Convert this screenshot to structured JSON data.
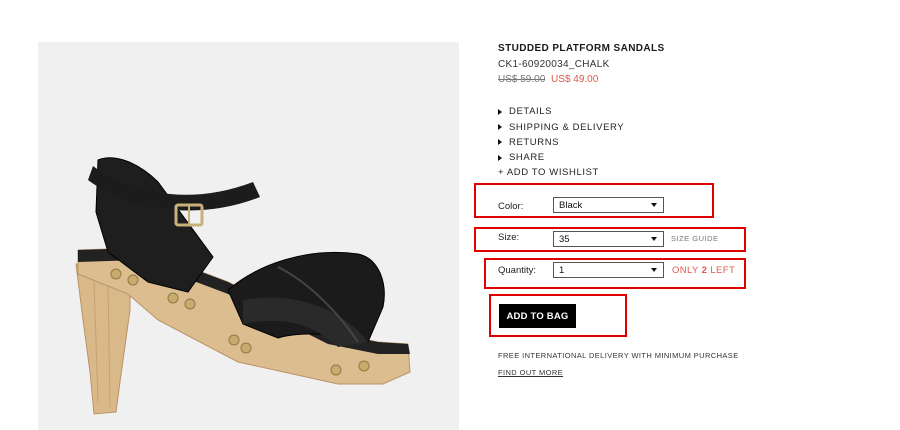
{
  "product": {
    "title": "STUDDED PLATFORM SANDALS",
    "sku": "CK1-60920034_CHALK",
    "old_price": "US$ 59.00",
    "new_price": "US$ 49.00",
    "image_icon": "sandal-product-photo"
  },
  "accordion": {
    "details": "DETAILS",
    "shipping": "SHIPPING & DELIVERY",
    "returns": "RETURNS",
    "share": "SHARE"
  },
  "wishlist": "+ ADD TO WISHLIST",
  "options": {
    "color_label": "Color:",
    "color_value": "Black",
    "size_label": "Size:",
    "size_value": "35",
    "size_guide": "SIZE GUIDE",
    "quantity_label": "Quantity:",
    "quantity_value": "1",
    "stock_prefix": "ONLY",
    "stock_count": "2",
    "stock_suffix": "LEFT"
  },
  "add_to_bag": "ADD TO BAG",
  "delivery_note": "FREE INTERNATIONAL DELIVERY WITH MINIMUM PURCHASE",
  "find_out_more": "FIND OUT MORE",
  "colors": {
    "sale_red": "#e2574c",
    "highlight_red": "#e00000",
    "button_black": "#000000"
  }
}
